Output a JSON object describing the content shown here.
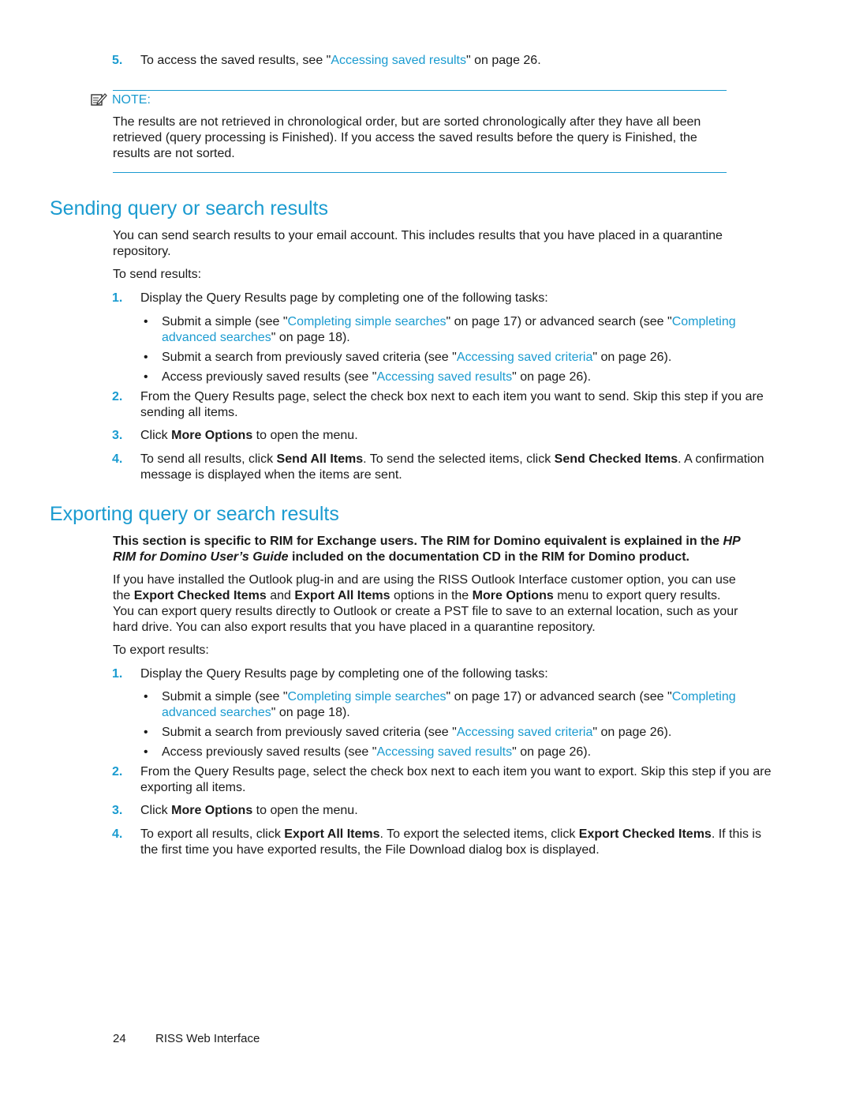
{
  "top_step": {
    "number": "5.",
    "pre": "To access the saved results, see \"",
    "link": "Accessing saved results",
    "post": "\" on page 26."
  },
  "note": {
    "icon": "note-pencil-icon",
    "label": "NOTE:",
    "text": "The results are not retrieved in chronological order, but are sorted chronologically after they have all been retrieved (query processing is Finished). If you access the saved results before the query is Finished, the results are not sorted."
  },
  "sending": {
    "heading": "Sending query or search results",
    "intro": "You can send search results to your email account. This includes results that you have placed in a quarantine repository.",
    "lead": "To send results:",
    "step1": {
      "number": "1.",
      "text": "Display the Query Results page by completing one of the following tasks:"
    },
    "bullets": [
      {
        "pre": "Submit a simple (see \"",
        "link1": "Completing simple searches",
        "mid": "\" on page 17) or advanced search (see \"",
        "link2": "Completing advanced searches",
        "post": "\" on page 18)."
      },
      {
        "pre": "Submit a search from previously saved criteria (see \"",
        "link": "Accessing saved criteria",
        "post": "\" on page 26)."
      },
      {
        "pre": "Access previously saved results (see \"",
        "link": "Accessing saved results",
        "post": "\" on page 26)."
      }
    ],
    "step2": {
      "number": "2.",
      "text": "From the Query Results page, select the check box next to each item you want to send. Skip this step if you are sending all items."
    },
    "step3": {
      "number": "3.",
      "pre": "Click ",
      "bold": "More Options",
      "post": " to open the menu."
    },
    "step4": {
      "number": "4.",
      "pre": "To send all results, click ",
      "bold1": "Send All Items",
      "mid": ". To send the selected items, click ",
      "bold2": "Send Checked Items",
      "post": ". A confirmation message is displayed when the items are sent."
    }
  },
  "exporting": {
    "heading": "Exporting query or search results",
    "bold_intro_pre": "This section is specific to RIM for Exchange users. The RIM for Domino equivalent is explained in the ",
    "bold_intro_italic": "HP RIM for Domino User’s Guide",
    "bold_intro_post": " included on the documentation CD in the RIM for Domino product.",
    "para": {
      "p1": "If you have installed the Outlook plug-in and are using the RISS Outlook Interface customer option, you can use the ",
      "b1": "Export Checked Items",
      "p2": " and ",
      "b2": "Export All Items",
      "p3": " options in the ",
      "b3": "More Options",
      "p4": " menu to export query results. You can export query results directly to Outlook or create a PST file to save to an external location, such as your hard drive. You can also export results that you have placed in a quarantine repository."
    },
    "lead": "To export results:",
    "step1": {
      "number": "1.",
      "text": "Display the Query Results page by completing one of the following tasks:"
    },
    "bullets": [
      {
        "pre": "Submit a simple (see \"",
        "link1": "Completing simple searches",
        "mid": "\" on page 17) or advanced search (see \"",
        "link2": "Completing advanced searches",
        "post": "\" on page 18)."
      },
      {
        "pre": "Submit a search from previously saved criteria (see \"",
        "link": "Accessing saved criteria",
        "post": "\" on page 26)."
      },
      {
        "pre": "Access previously saved results (see \"",
        "link": "Accessing saved results",
        "post": "\" on page 26)."
      }
    ],
    "step2": {
      "number": "2.",
      "text": "From the Query Results page, select the check box next to each item you want to export. Skip this step if you are exporting all items."
    },
    "step3": {
      "number": "3.",
      "pre": "Click ",
      "bold": "More Options",
      "post": " to open the menu."
    },
    "step4": {
      "number": "4.",
      "pre": "To export all results, click ",
      "bold1": "Export All Items",
      "mid": ". To export the selected items, click ",
      "bold2": "Export Checked Items",
      "post": ". If this is the first time you have exported results, the File Download dialog box is displayed."
    }
  },
  "footer": {
    "page": "24",
    "title": "RISS Web Interface"
  },
  "colors": {
    "accent": "#1a9bd0",
    "text": "#1a1a1a"
  }
}
